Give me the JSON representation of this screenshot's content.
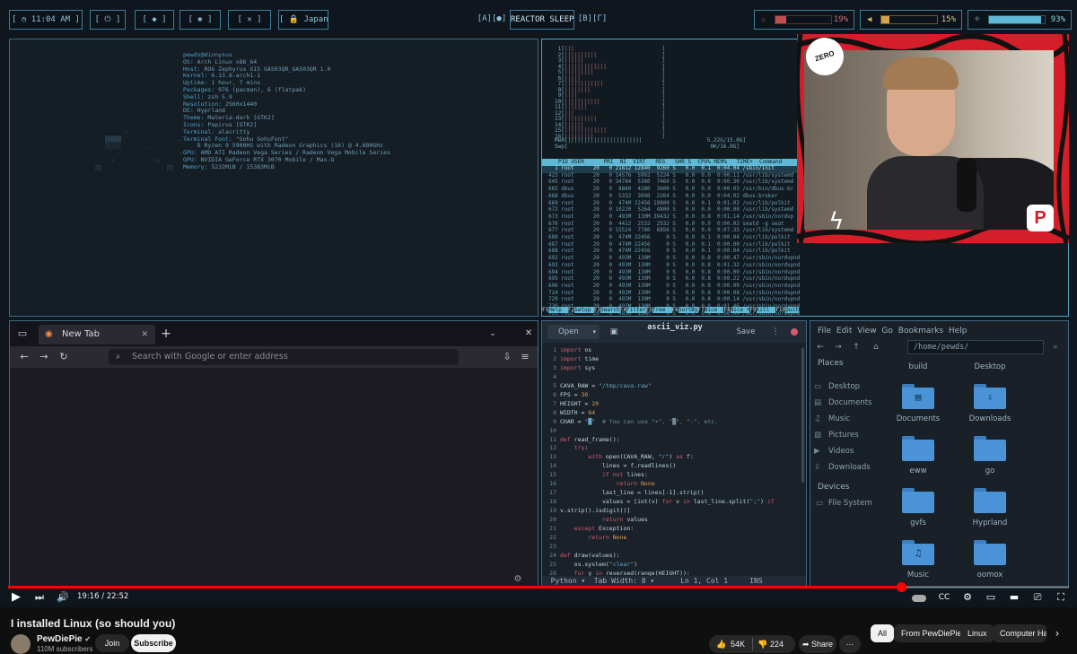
{
  "topbar": {
    "clock": "[ ◷ 11:04 AM ]",
    "power": "[ ⏻ ]",
    "wifi": "[ ◆ ]",
    "bluetooth": "[ ✱ ]",
    "mic": "[ ✕ ]",
    "lock": "[ 🔒 Japan",
    "ws_left": "[A][●]",
    "reactor": "REACTOR SLEEP",
    "ws_right": "[B][Γ]",
    "temp_pct": "19%",
    "temp_value": 0.19,
    "volume_pct": "15%",
    "volume_value": 0.15,
    "brightness_pct": "93%",
    "brightness_value": 0.93
  },
  "neofetch": {
    "user": "pewds@dionysus",
    "rows": [
      {
        "k": "OS:",
        "v": " Arch Linux x86_64"
      },
      {
        "k": "Host:",
        "v": " ROG Zephyrus G15 GA503QR_GA503QR 1.0"
      },
      {
        "k": "Kernel:",
        "v": " 6.13.8-arch1-1"
      },
      {
        "k": "Uptime:",
        "v": " 1 hour, 7 mins"
      },
      {
        "k": "Packages:",
        "v": " 976 (pacman), 6 (flatpak)"
      },
      {
        "k": "Shell:",
        "v": " zsh 5.9"
      },
      {
        "k": "Resolution:",
        "v": " 2560x1440"
      },
      {
        "k": "DE:",
        "v": " Hyprland"
      },
      {
        "k": "Theme:",
        "v": " Materia-dark [GTK2]"
      },
      {
        "k": "Icons:",
        "v": " Papirus [GTK2]"
      },
      {
        "k": "Terminal:",
        "v": " alacritty"
      },
      {
        "k": "Terminal Font:",
        "v": " \"Gohu GohuFont\""
      },
      {
        "k": "",
        "v": "    D Ryzen 9 5900HS with Radeon Graphics (16) @ 4.680GHz"
      },
      {
        "k": "GPU:",
        "v": " AMD ATI Radeon Vega Series / Radeon Vega Mobile Series"
      },
      {
        "k": "GPU:",
        "v": " NVIDIA GeForce RTX 3070 Mobile / Max-Q"
      },
      {
        "k": "Memory:",
        "v": " 5232MiB / 15383MiB"
      }
    ]
  },
  "htop": {
    "header": "PID USER      PRI  NI  VIRT   RES   SHR S  CPU% MEM%   TIME+  Command",
    "mem": "Mem[|||||||||||||||||||||||                    5.22G/15.0G]",
    "swp": "Swp[                                            0K/16.0G]",
    "rows": [
      "    1 root      20   0 21812 12840  9260 S   0.0  0.1  0:04.04 /sbin/init",
      "  423 root      20   0 14576  5992  5224 S   0.0  0.0  0:00.11 /usr/lib/systemd",
      "  645 root      20   0 34784  5380  7460 S   0.0  0.0  0:00.30 /usr/lib/systemd",
      "  665 dbus      20   0  8860  4280  3600 S   0.0  0.0  0:00.03 /usr/bin/dbus-br",
      "  668 dbus      20   0  5332  3008  2264 S   0.0  0.0  0:04.02 dbus-broker",
      "  669 root      20   0  474M 22456 19800 S   0.0  0.1  0:01.02 /usr/lib/polkit",
      "  672 root      20   0 10220  5264  4800 S   0.0  0.0  0:00.00 /usr/lib/systemd",
      "  673 root      20   0  493M  130M 39432 S   0.0  0.8  0:01.14 /usr/sbin/nordvp",
      "  676 root      20   0  4412  2532  2532 S   0.0  0.0  0:00.02 seatd -g seat",
      "  677 root      20   0 15524  7780  6856 S   0.0  0.0  0:07.35 /usr/lib/systemd",
      "  680 root      20   0  474M 22456     0 S   0.0  0.1  0:00.04 /usr/lib/polkit",
      "  687 root      20   0  474M 22456     0 S   0.0  0.1  0:00.00 /usr/lib/polkit",
      "  688 root      20   0  474M 22456     0 S   0.0  0.1  0:00.04 /usr/lib/polkit",
      "  692 root      20   0  493M  130M     0 S   0.0  0.8  0:00.47 /usr/sbin/nordvpnd",
      "  693 root      20   0  493M  130M     0 S   0.0  0.8  0:01.32 /usr/sbin/nordvpnd",
      "  694 root      20   0  493M  130M     0 S   0.0  0.8  0:00.00 /usr/sbin/nordvpnd",
      "  695 root      20   0  493M  130M     0 S   0.0  0.8  0:00.22 /usr/sbin/nordvpnd",
      "  696 root      20   0  493M  130M     0 S   0.0  0.8  0:00.00 /usr/sbin/nordvpnd",
      "  724 root      20   0  493M  130M     0 S   0.0  0.8  0:00.08 /usr/sbin/nordvpnd",
      "  729 root      20   0  493M  130M     0 S   0.0  0.8  0:00.14 /usr/sbin/nordvpnd",
      "  730 root      20   0  493M  130M     0 S   0.0  0.8  0:01.46 /usr/sbin/nordvpnd",
      "  731 root      20   0  493M  130M     0 S   0.0  0.8  0:00.00 /usr/sbin/nordvpnd",
      "  732 root      20   0  493M  130M     0 S   0.0  0.8  0:01.50 /usr/sbin/nordvpnd",
      "  740 root      20   0  493M  130M     0 S   0.0  0.8  0:00.67 /usr/sbin/nordvpnd"
    ],
    "footer": [
      {
        "k": "F1",
        "v": "Help  "
      },
      {
        "k": "F2",
        "v": "Setup "
      },
      {
        "k": "F3",
        "v": "Search"
      },
      {
        "k": "F4",
        "v": "Filter"
      },
      {
        "k": "F5",
        "v": "Tree  "
      },
      {
        "k": "F6",
        "v": "SortBy"
      },
      {
        "k": "F7",
        "v": "Nice -"
      },
      {
        "k": "F8",
        "v": "Nice +"
      },
      {
        "k": "F9",
        "v": "Kill  "
      },
      {
        "k": "F10",
        "v": "Quit"
      }
    ]
  },
  "webcam": {
    "badge": "ZERO"
  },
  "browser": {
    "tab_title": "New Tab",
    "url_placeholder": "Search with Google or enter address",
    "back": "←",
    "forward": "→",
    "reload": "↻",
    "new_tab": "+",
    "close": "✕",
    "extensions": "⇩",
    "menu": "≡",
    "settings": "⚙"
  },
  "editor": {
    "open_label": "Open",
    "filename": "ascii_viz.py",
    "save_label": "Save",
    "lines": [
      [
        [
          "kw",
          "import"
        ],
        [
          "fn",
          " os"
        ]
      ],
      [
        [
          "kw",
          "import"
        ],
        [
          "fn",
          " time"
        ]
      ],
      [
        [
          "kw",
          "import"
        ],
        [
          "fn",
          " sys"
        ]
      ],
      [],
      [
        [
          "fn",
          "CAVA_RAW = "
        ],
        [
          "st",
          "\"/tmp/cava.raw\""
        ]
      ],
      [
        [
          "fn",
          "FPS = "
        ],
        [
          "nm",
          "30"
        ]
      ],
      [
        [
          "fn",
          "HEIGHT = "
        ],
        [
          "nm",
          "20"
        ]
      ],
      [
        [
          "fn",
          "WIDTH = "
        ],
        [
          "nm",
          "64"
        ]
      ],
      [
        [
          "fn",
          "CHAR = "
        ],
        [
          "st",
          "\"█\""
        ],
        [
          "cm",
          "  # You can use \"•\", \"█\", \"-\", etc."
        ]
      ],
      [],
      [
        [
          "kw",
          "def"
        ],
        [
          "fn",
          " read_frame():"
        ]
      ],
      [
        [
          "kw",
          "    try"
        ],
        [
          "fn",
          ":"
        ]
      ],
      [
        [
          "kw",
          "        with"
        ],
        [
          "fn",
          " open(CAVA_RAW, "
        ],
        [
          "st",
          "\"r\""
        ],
        [
          "fn",
          ") "
        ],
        [
          "kw",
          "as"
        ],
        [
          "fn",
          " f:"
        ]
      ],
      [
        [
          "fn",
          "            lines = f.readlines()"
        ]
      ],
      [
        [
          "kw",
          "            if not"
        ],
        [
          "fn",
          " lines:"
        ]
      ],
      [
        [
          "kw",
          "                return"
        ],
        [
          "nm",
          " None"
        ]
      ],
      [
        [
          "fn",
          "            last_line = lines[-1].strip()"
        ]
      ],
      [
        [
          "fn",
          "            values = [int(v) "
        ],
        [
          "kw",
          "for"
        ],
        [
          "fn",
          " v "
        ],
        [
          "kw",
          "in"
        ],
        [
          "fn",
          " last_line.split("
        ],
        [
          "st",
          "\";\""
        ],
        [
          "fn",
          ") "
        ],
        [
          "kw",
          "if"
        ]
      ],
      [
        [
          "fn",
          "v.strip().isdigit()]"
        ]
      ],
      [
        [
          "kw",
          "            return"
        ],
        [
          "fn",
          " values"
        ]
      ],
      [
        [
          "kw",
          "    except"
        ],
        [
          "fn",
          " Exception:"
        ]
      ],
      [
        [
          "kw",
          "        return"
        ],
        [
          "nm",
          " None"
        ]
      ],
      [],
      [
        [
          "kw",
          "def"
        ],
        [
          "fn",
          " draw(values):"
        ]
      ],
      [
        [
          "fn",
          "    os.system("
        ],
        [
          "st",
          "\"clear\""
        ],
        [
          "fn",
          ")"
        ]
      ],
      [
        [
          "kw",
          "    for"
        ],
        [
          "fn",
          " y "
        ],
        [
          "kw",
          "in"
        ],
        [
          "fn",
          " reversed(range(HEIGHT)):"
        ]
      ],
      [
        [
          "fn",
          "        line = \"\""
        ]
      ]
    ],
    "gutter": [
      "1",
      "2",
      "3",
      "4",
      "5",
      "6",
      "7",
      "8",
      "9",
      "10",
      "11",
      "12",
      "13",
      "14",
      "15",
      "16",
      "17",
      "18",
      "",
      "19",
      "20",
      "21",
      "22",
      "23",
      "24",
      "25",
      "26"
    ],
    "status": "  Python ▾  Tab Width: 8 ▾      Ln 1, Col 1     INS"
  },
  "files": {
    "menu": "File  Edit  View  Go  Bookmarks  Help",
    "path": "/home/pewds/",
    "places_title": "Places",
    "places": [
      "Desktop",
      "Documents",
      "Music",
      "Pictures",
      "Videos",
      "Downloads"
    ],
    "devices_title": "Devices",
    "devices": [
      "File System"
    ],
    "folders": [
      {
        "name": "build"
      },
      {
        "name": "Desktop"
      },
      {
        "name": "Documents"
      },
      {
        "name": "Downloads"
      },
      {
        "name": "eww"
      },
      {
        "name": "go"
      },
      {
        "name": "gvfs"
      },
      {
        "name": "Hyprland"
      },
      {
        "name": "Music"
      },
      {
        "name": "oomox"
      }
    ]
  },
  "player": {
    "time": "19:16 / 22:52",
    "progress": 0.842
  },
  "video": {
    "title": "I installed Linux (so should you)",
    "channel": "PewDiePie",
    "subscribers": "110M subscribers",
    "join": "Join",
    "subscribe": "Subscribe",
    "likes": "54K",
    "dislikes": "224",
    "share": "Share",
    "more": "···",
    "chips": [
      "All",
      "From PewDiePie",
      "Linux",
      "Computer Ha"
    ]
  },
  "colors": {
    "accent": "#4ea2c4",
    "webcam_frame": "#d41f2b",
    "progress": "#ff0000"
  }
}
